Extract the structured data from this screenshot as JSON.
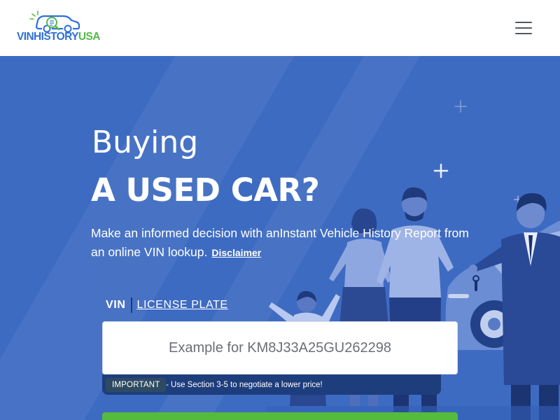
{
  "header": {
    "logo": {
      "part1": "VINHISTORY",
      "part2": "USA",
      "colors": {
        "primary": "#2f6fd8",
        "accent": "#55b947"
      },
      "icon": "car-magnifier-logo-icon"
    },
    "menu_icon": "hamburger-menu-icon"
  },
  "hero": {
    "title_line1": "Buying",
    "title_line2": "A USED CAR?",
    "subtitle": "Make an informed decision with anInstant Vehicle History Report from an online VIN lookup.",
    "disclaimer_link": "Disclaimer",
    "background_color": "#3e6bc2",
    "illustration": "family-and-car-dealer-illustration"
  },
  "search": {
    "tabs": [
      {
        "label": "VIN",
        "active": true
      },
      {
        "label": "LICENSE PLATE",
        "active": false
      }
    ],
    "placeholder": "Example for KM8J33A25GU262298",
    "value": "",
    "notice": {
      "badge": "IMPORTANT",
      "text": "- Use Section 3-5 to negotiate a lower price!"
    },
    "submit_button": {
      "label": "",
      "color": "#55bb3d"
    }
  }
}
